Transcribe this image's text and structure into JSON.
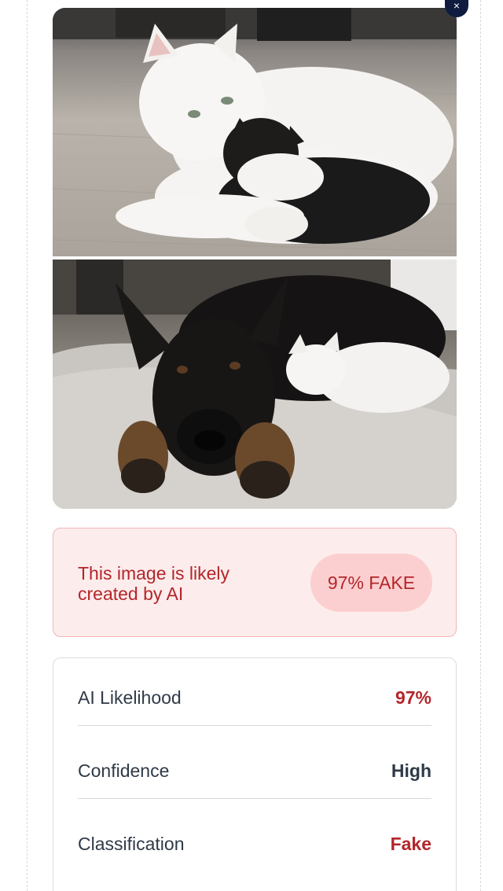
{
  "close_button": {
    "icon": "close-icon",
    "glyph": "×"
  },
  "image": {
    "top_photo": "cat-with-puppy-photo",
    "bottom_photo": "dog-with-cat-photo"
  },
  "verdict": {
    "message": "This image is likely created by AI",
    "badge": "97% FAKE",
    "color": "#b3262b"
  },
  "details": [
    {
      "label": "AI Likelihood",
      "value": "97%"
    },
    {
      "label": "Confidence",
      "value": "High"
    },
    {
      "label": "Classification",
      "value": "Fake"
    }
  ]
}
